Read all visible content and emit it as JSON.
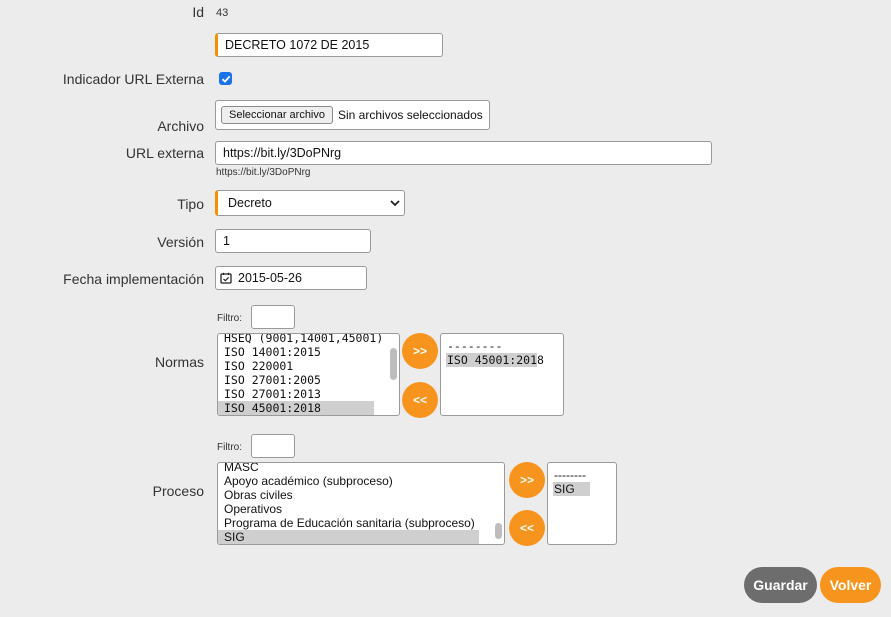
{
  "form": {
    "id": {
      "label": "Id",
      "value": "43"
    },
    "name": {
      "value": "DECRETO 1072 DE 2015"
    },
    "external_url_indicator": {
      "label": "Indicador URL Externa",
      "checked": true
    },
    "file": {
      "label": "Archivo",
      "button": "Seleccionar archivo",
      "status": "Sin archivos seleccionados"
    },
    "external_url": {
      "label": "URL externa",
      "value": "https://bit.ly/3DoPNrg",
      "hint": "https://bit.ly/3DoPNrg"
    },
    "type": {
      "label": "Tipo",
      "selected": "Decreto"
    },
    "version": {
      "label": "Versión",
      "value": "1"
    },
    "implementation_date": {
      "label": "Fecha implementación",
      "value": "2015-05-26"
    }
  },
  "normas": {
    "label": "Normas",
    "filter_label": "Filtro:",
    "available": [
      "HSEQ (9001,14001,45001)",
      "ISO 14001:2015",
      "ISO 220001",
      "ISO 27001:2005",
      "ISO 27001:2013",
      "ISO 45001:2018"
    ],
    "available_selected_index": 5,
    "chosen": [
      "--------",
      "ISO 45001:2018"
    ],
    "chosen_selected_index": 1,
    "add_label": ">>",
    "remove_label": "<<"
  },
  "proceso": {
    "label": "Proceso",
    "filter_label": "Filtro:",
    "available": [
      "MASC",
      "Apoyo académico (subproceso)",
      "Obras civiles",
      "Operativos",
      "Programa de Educación sanitaria (subproceso)",
      "SIG"
    ],
    "available_selected_index": 5,
    "chosen": [
      "--------",
      "SIG"
    ],
    "chosen_selected_index": 1,
    "add_label": ">>",
    "remove_label": "<<"
  },
  "actions": {
    "save": "Guardar",
    "back": "Volver"
  },
  "colors": {
    "accent": "#f7941d",
    "save_bg": "#6d6d6d",
    "checkbox": "#1a73e8",
    "background": "#ececec"
  },
  "icons": {
    "calendar": "calendar-check-icon",
    "dropdown": "chevron-down-icon",
    "check": "check-icon"
  }
}
